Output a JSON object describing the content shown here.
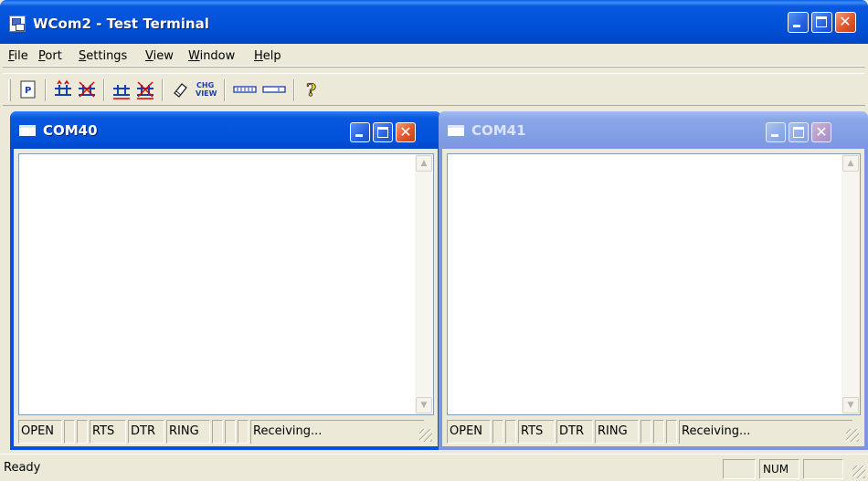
{
  "window": {
    "title": "WCom2 - Test Terminal"
  },
  "menu": {
    "items": [
      "File",
      "Port",
      "Settings",
      "View",
      "Window",
      "Help"
    ]
  },
  "toolbar": {
    "buttons": [
      {
        "name": "properties-icon",
        "glyph": "P"
      },
      {
        "name": "connect-icon",
        "glyph": ""
      },
      {
        "name": "disconnect-icon",
        "glyph": ""
      },
      {
        "name": "connect-all-icon",
        "glyph": ""
      },
      {
        "name": "disconnect-all-icon",
        "glyph": ""
      },
      {
        "name": "clear-icon",
        "glyph": ""
      },
      {
        "name": "change-view-icon",
        "glyph": "CHG VIEW"
      },
      {
        "name": "hex-view-icon",
        "glyph": ""
      },
      {
        "name": "text-view-icon",
        "glyph": ""
      },
      {
        "name": "help-icon",
        "glyph": "?"
      }
    ]
  },
  "children": [
    {
      "title": "COM40",
      "active": true,
      "status": [
        "OPEN",
        "",
        "",
        "RTS",
        "DTR",
        "RING",
        "",
        "",
        "",
        "Receiving..."
      ]
    },
    {
      "title": "COM41",
      "active": false,
      "status": [
        "OPEN",
        "",
        "",
        "RTS",
        "DTR",
        "RING",
        "",
        "",
        "",
        "Receiving..."
      ]
    }
  ],
  "statusbar": {
    "ready": "Ready",
    "num": "NUM"
  },
  "colors": {
    "xp_blue": "#0050d8",
    "inactive_blue": "#7b98e0",
    "close_red": "#e2572b",
    "face": "#ece9d8"
  }
}
